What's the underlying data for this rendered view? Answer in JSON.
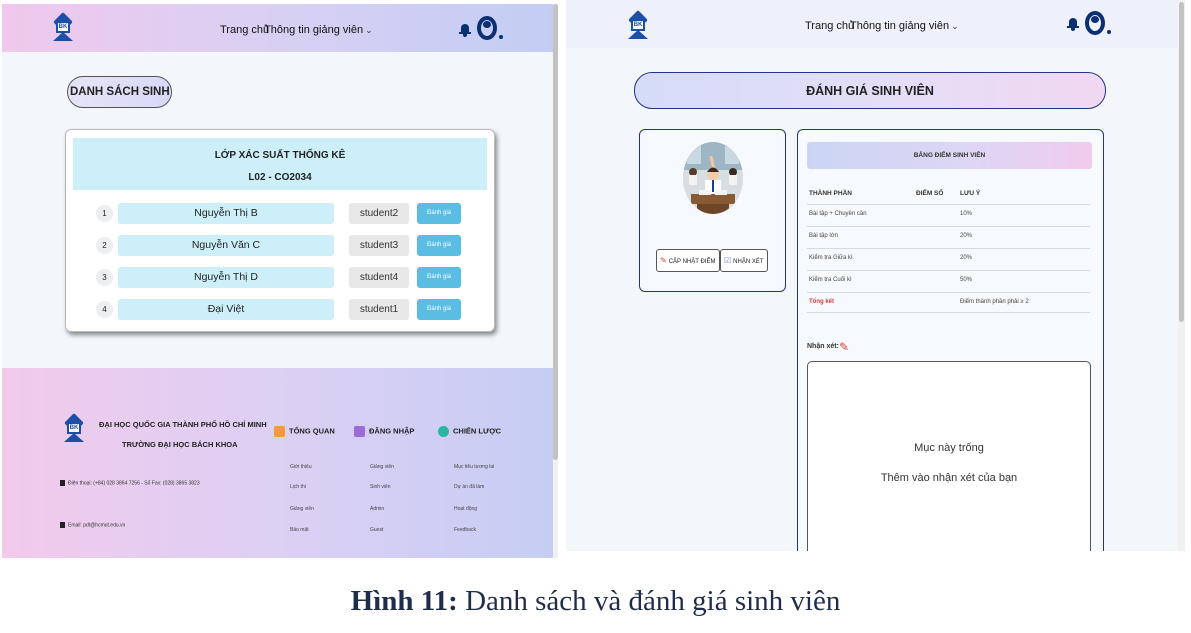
{
  "left": {
    "nav": {
      "home": "Trang chủ",
      "lecturer_info": "Thông tin giảng viên",
      "chevron": "⌄"
    },
    "list_title": "DANH SÁCH SINH VIÊN",
    "class": {
      "name": "LỚP XÁC SUẤT THỐNG KÊ",
      "code": "L02 - CO2034",
      "students": [
        {
          "index": "1",
          "name": "Nguyễn Thị B",
          "account": "student2",
          "action": "Đánh giá"
        },
        {
          "index": "2",
          "name": "Nguyễn Văn C",
          "account": "student3",
          "action": "Đánh giá"
        },
        {
          "index": "3",
          "name": "Nguyễn Thị D",
          "account": "student4",
          "action": "Đánh giá"
        },
        {
          "index": "4",
          "name": "Đại Việt",
          "account": "student1",
          "action": "Đánh giá"
        }
      ]
    },
    "footer": {
      "logo_text": "BK",
      "university": "ĐẠI HỌC QUỐC GIA THÀNH PHỐ HỒ CHÍ MINH",
      "school": "TRƯỜNG ĐẠI HỌC BÁCH KHOA",
      "phone": "Điện thoại: (+84) 028 3864 7256 - Số Fax: (028) 3865 3823",
      "email": "Email: pdt@hcmut.edu.vn",
      "columns": [
        {
          "title": "TỔNG QUAN",
          "icon": "home-icon",
          "color": "#f39b3a",
          "links": [
            "Giới thiệu",
            "Lịch thi",
            "Giảng viên",
            "Bảo mật"
          ]
        },
        {
          "title": "ĐĂNG NHẬP",
          "icon": "users-icon",
          "color": "#9b6bd6",
          "links": [
            "Giảng viên",
            "Sinh viên",
            "Admin",
            "Guest"
          ]
        },
        {
          "title": "CHIẾN LƯỢC",
          "icon": "target-icon",
          "color": "#2bb5a0",
          "links": [
            "Mục tiêu tương lai",
            "Dự án đã làm",
            "Hoạt động",
            "Feedback"
          ]
        }
      ]
    }
  },
  "right": {
    "nav": {
      "home": "Trang chủ",
      "lecturer_info": "Thông tin giảng viên",
      "chevron": "⌄"
    },
    "eval_title": "ĐÁNH GIÁ SINH VIÊN",
    "actions": {
      "update_score": "CẬP NHẬT ĐIỂM",
      "comment": "NHẬN XÉT"
    },
    "grade_table": {
      "title": "BẢNG ĐIỂM SINH VIÊN",
      "headers": {
        "component": "THÀNH PHẦN",
        "score": "ĐIỂM SỐ",
        "note": "LƯU Ý"
      },
      "rows": [
        {
          "component": "Bài tập + Chuyên cần",
          "score": "",
          "note": "10%"
        },
        {
          "component": "Bài tập lớn",
          "score": "",
          "note": "20%"
        },
        {
          "component": "Kiểm tra Giữa kì",
          "score": "",
          "note": "20%"
        },
        {
          "component": "Kiểm tra Cuối kì",
          "score": "",
          "note": "50%"
        }
      ],
      "total": {
        "component": "Tổng kết",
        "score": "",
        "note": "Điểm thành phần phải ≥ 2"
      }
    },
    "comment": {
      "label": "Nhận xét:",
      "empty": "Mục này trống",
      "hint": "Thêm vào nhận xét của bạn"
    }
  },
  "caption": {
    "label": "Hình 11:",
    "text": " Danh sách và đánh giá sinh viên"
  }
}
